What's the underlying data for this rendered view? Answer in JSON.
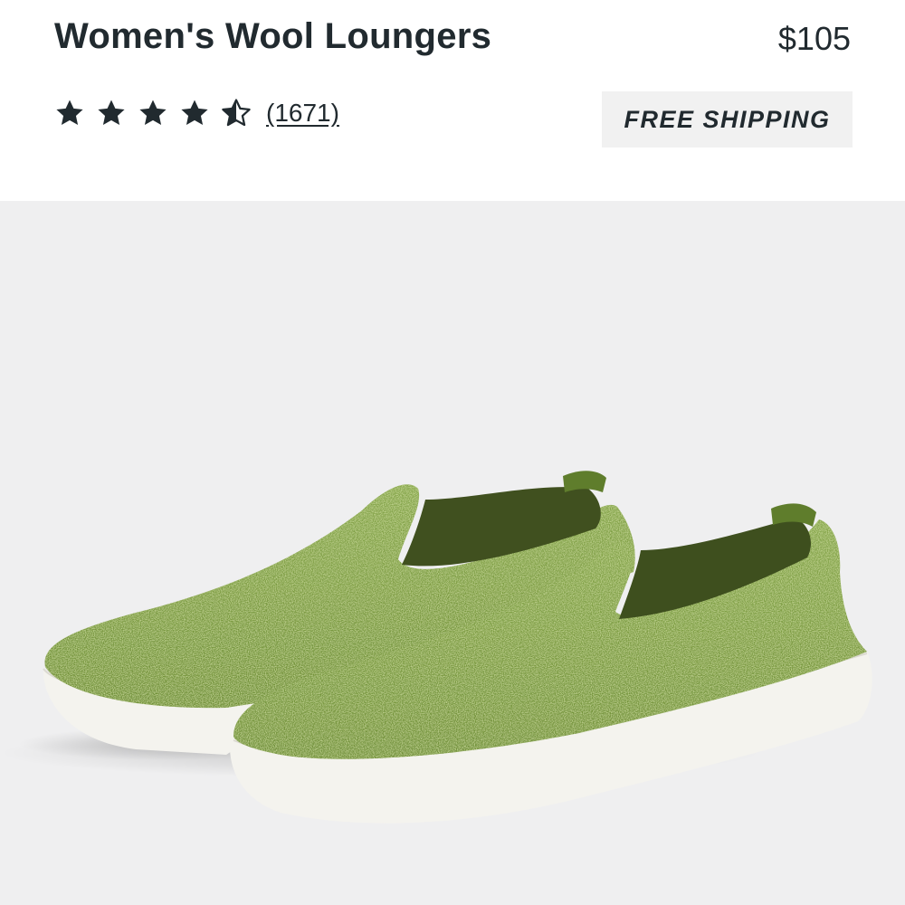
{
  "product": {
    "name": "Women's Wool Loungers",
    "price": "$105"
  },
  "rating": {
    "value": 4.5,
    "max": 5,
    "review_count": "(1671)"
  },
  "badge": {
    "shipping": "FREE SHIPPING"
  },
  "image": {
    "alt": "Women's Wool Loungers",
    "shoe_color": "#7a9a3f",
    "sole_color": "#f4f3ee",
    "background_color": "#efeff0"
  }
}
